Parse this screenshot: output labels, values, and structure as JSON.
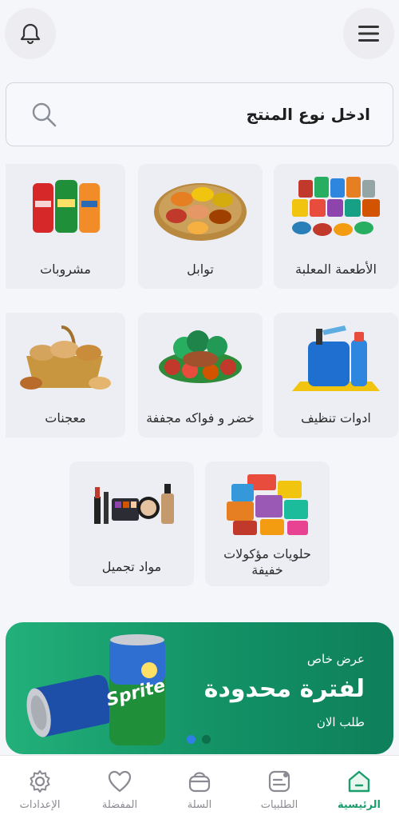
{
  "header": {
    "bell_icon": "bell-icon",
    "menu_icon": "menu-icon"
  },
  "search": {
    "placeholder": "ادخل نوع المنتج",
    "icon": "search-icon"
  },
  "categories": [
    {
      "label": "الأطعمة المعلبة",
      "image": "canned-food-image"
    },
    {
      "label": "توابل",
      "image": "spices-image"
    },
    {
      "label": "مشروبات",
      "image": "drinks-image"
    },
    {
      "label": "ادوات تنظيف",
      "image": "cleaning-supplies-image"
    },
    {
      "label": "خضر و فواكه مجففة",
      "image": "vegetables-fruits-image"
    },
    {
      "label": "معجنات",
      "image": "pastries-image"
    },
    {
      "label": "حلويات مؤكولات خفيفة",
      "image": "sweets-snacks-image"
    },
    {
      "label": "مواد تجميل",
      "image": "cosmetics-image"
    }
  ],
  "banner": {
    "kicker": "عرض خاص",
    "title": "لفترة محدودة",
    "cta": "طلب الان",
    "active_slide": 2,
    "slides": 2,
    "colors": {
      "start": "#22b07a",
      "end": "#0e7f5a"
    }
  },
  "nav": [
    {
      "label": "الرئيسية",
      "icon": "home-icon",
      "active": true
    },
    {
      "label": "الطلبيات",
      "icon": "orders-icon",
      "active": false
    },
    {
      "label": "السلة",
      "icon": "basket-icon",
      "active": false
    },
    {
      "label": "المفضلة",
      "icon": "heart-icon",
      "active": false
    },
    {
      "label": "الإعدادات",
      "icon": "gear-icon",
      "active": false
    }
  ],
  "colors": {
    "accent": "#1a9e6d",
    "background": "#f5f6fa",
    "card": "#eceef3"
  }
}
